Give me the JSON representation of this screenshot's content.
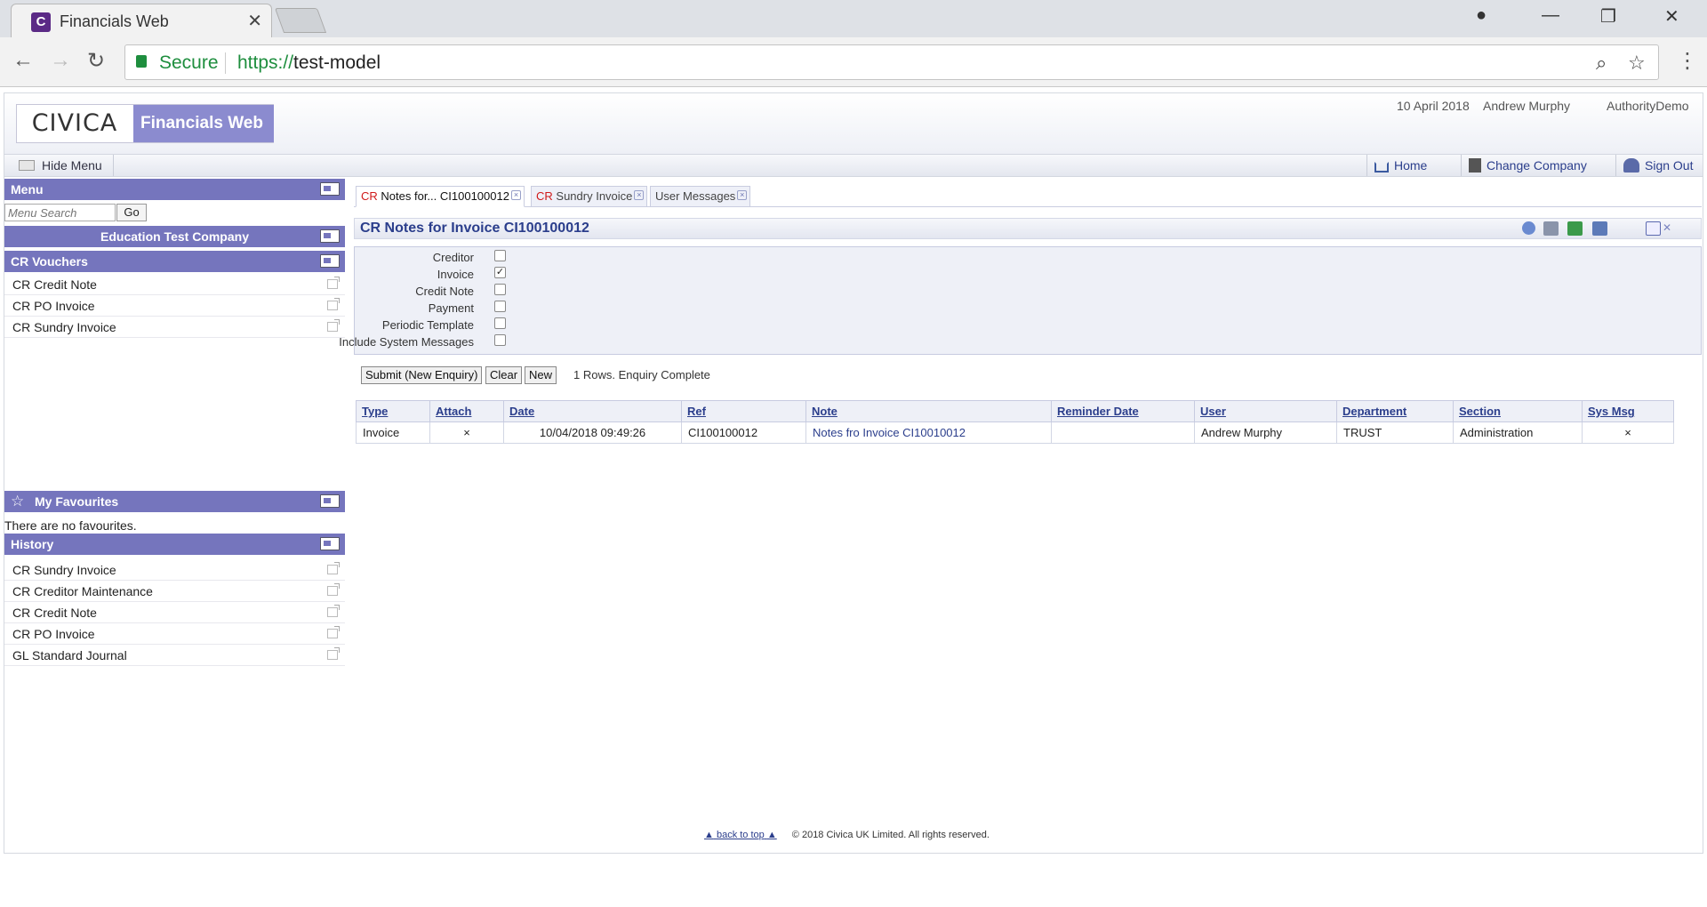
{
  "browser": {
    "tab_title": "Financials Web",
    "favicon_letter": "C",
    "secure_label": "Secure",
    "url_protocol": "https://",
    "url_host": "test-model"
  },
  "header": {
    "logo_brand": "CIVICA",
    "logo_product": "Financials Web",
    "date": "10 April 2018",
    "user": "Andrew Murphy",
    "authority": "AuthorityDemo"
  },
  "toolbar": {
    "hide_menu": "Hide Menu",
    "home": "Home",
    "change_company": "Change Company",
    "sign_out": "Sign Out"
  },
  "sidebar": {
    "menu_title": "Menu",
    "search_placeholder": "Menu Search",
    "go_label": "Go",
    "company": "Education Test Company",
    "vouchers_title": "CR Vouchers",
    "vouchers": [
      "CR Credit Note",
      "CR PO Invoice",
      "CR Sundry Invoice"
    ],
    "favourites_title": "My Favourites",
    "no_favourites": "There are no favourites.",
    "history_title": "History",
    "history": [
      "CR Sundry Invoice",
      "CR Creditor Maintenance",
      "CR Credit Note",
      "CR PO Invoice",
      "GL Standard Journal"
    ]
  },
  "tabs": [
    {
      "prefix": "CR",
      "label": "Notes for... CI100100012",
      "active": true
    },
    {
      "prefix": "CR",
      "label": "Sundry Invoice",
      "active": false
    },
    {
      "prefix": "",
      "label": "User Messages",
      "active": false
    }
  ],
  "panel": {
    "title": "CR Notes for Invoice CI100100012"
  },
  "filters": [
    {
      "label": "Creditor",
      "checked": false
    },
    {
      "label": "Invoice",
      "checked": true
    },
    {
      "label": "Credit Note",
      "checked": false
    },
    {
      "label": "Payment",
      "checked": false
    },
    {
      "label": "Periodic Template",
      "checked": false
    },
    {
      "label": "Include System Messages",
      "checked": false
    }
  ],
  "actions": {
    "submit": "Submit (New Enquiry)",
    "clear": "Clear",
    "new": "New",
    "status": "1 Rows. Enquiry Complete"
  },
  "table": {
    "columns": [
      "Type",
      "Attach",
      "Date",
      "Ref",
      "Note",
      "Reminder Date",
      "User",
      "Department",
      "Section",
      "Sys Msg"
    ],
    "rows": [
      [
        "Invoice",
        "×",
        "10/04/2018 09:49:26",
        "CI100100012",
        "Notes fro Invoice CI10010012",
        "",
        "Andrew Murphy",
        "TRUST",
        "Administration",
        "×"
      ]
    ]
  },
  "footer": {
    "back_to_top": "back to top",
    "copyright": "© 2018 Civica UK Limited. All rights reserved."
  },
  "colors": {
    "accent": "#7575bd",
    "link": "#2b3e8c",
    "cr_red": "#d01a1a",
    "secure_green": "#1e8e3e"
  }
}
